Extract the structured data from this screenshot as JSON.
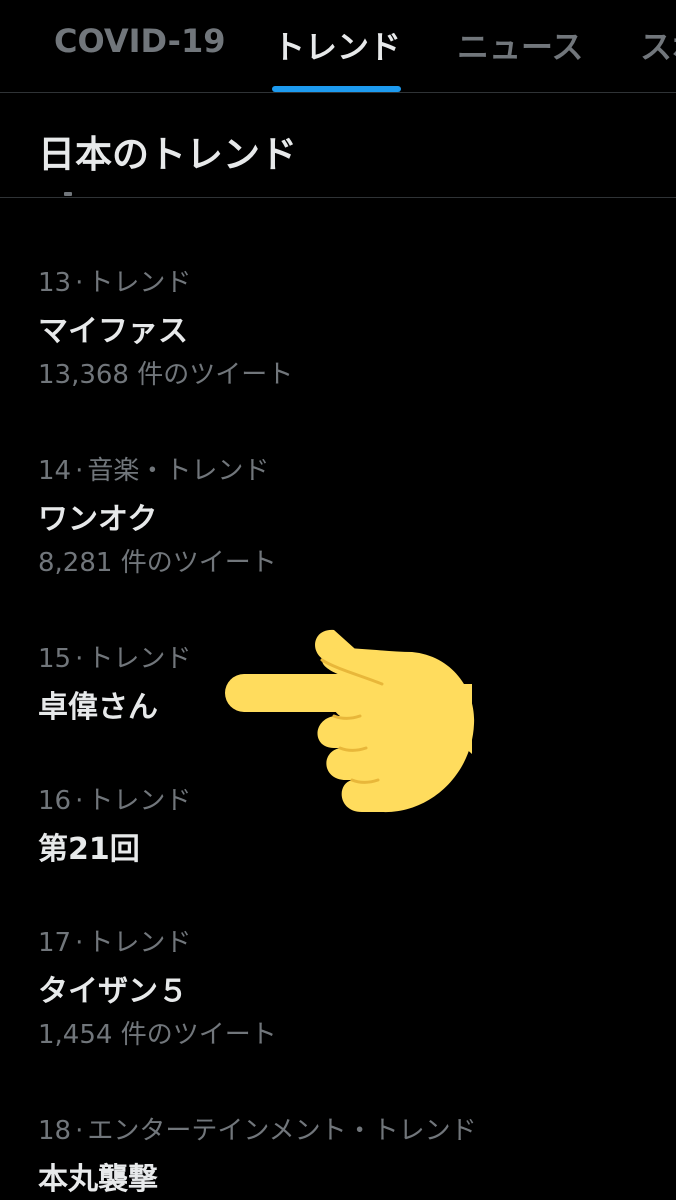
{
  "tabs": [
    {
      "label": "COVID-19",
      "active": false
    },
    {
      "label": "トレンド",
      "active": true
    },
    {
      "label": "ニュース",
      "active": false
    },
    {
      "label": "スポ",
      "active": false
    }
  ],
  "section_title": "日本のトレンド",
  "accent_color": "#1d9bf0",
  "trends": [
    {
      "rank": "13",
      "category": "トレンド",
      "name": "マイファス",
      "tweet_count": "13,368 件のツイート"
    },
    {
      "rank": "14",
      "category": "音楽・トレンド",
      "name": "ワンオク",
      "tweet_count": "8,281 件のツイート"
    },
    {
      "rank": "15",
      "category": "トレンド",
      "name": "卓偉さん",
      "tweet_count": ""
    },
    {
      "rank": "16",
      "category": "トレンド",
      "name": "第21回",
      "tweet_count": ""
    },
    {
      "rank": "17",
      "category": "トレンド",
      "name": "タイザン５",
      "tweet_count": "1,454 件のツイート"
    },
    {
      "rank": "18",
      "category": "エンターテインメント・トレンド",
      "name": "本丸襲撃",
      "tweet_count": ""
    }
  ],
  "overlay": {
    "icon": "pointing-hand-icon",
    "color": "#ffdc5d"
  }
}
